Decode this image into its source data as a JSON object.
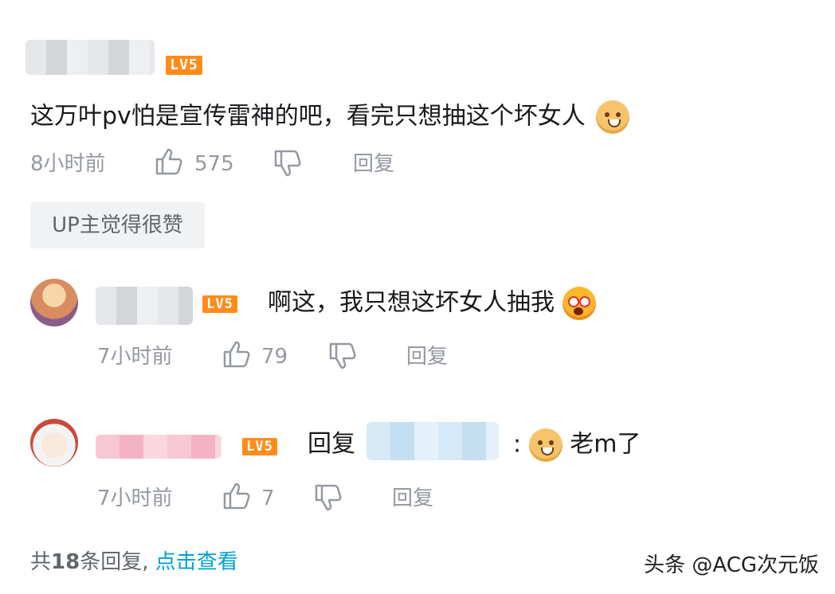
{
  "comment_main": {
    "level": "LV5",
    "text": "这万叶pv怕是宣传雷神的吧，看完只想抽这个坏女人",
    "time": "8小时前",
    "likes": "575",
    "reply_label": "回复",
    "up_badge": "UP主觉得很赞"
  },
  "reply_1": {
    "level": "LV5",
    "text": "啊这，我只想这坏女人抽我",
    "time": "7小时前",
    "likes": "79",
    "reply_label": "回复"
  },
  "reply_2": {
    "level": "LV5",
    "prefix": "回复",
    "colon": ":",
    "text": "老m了",
    "time": "7小时前",
    "likes": "7",
    "reply_label": "回复"
  },
  "footer": {
    "total_prefix": "共",
    "total_count": "18",
    "total_suffix": "条回复,",
    "view_link": "点击查看",
    "watermark": "头条 @ACG次元饭"
  },
  "icons": {
    "like": "thumbs-up-icon",
    "dislike": "thumbs-down-icon",
    "emoji_doge": "doge-emoji-icon",
    "emoji_shock": "shocked-emoji-icon"
  },
  "colors": {
    "level_badge": "#ff8c1a",
    "meta_gray": "#9499a0",
    "link_blue": "#00a1d6"
  }
}
